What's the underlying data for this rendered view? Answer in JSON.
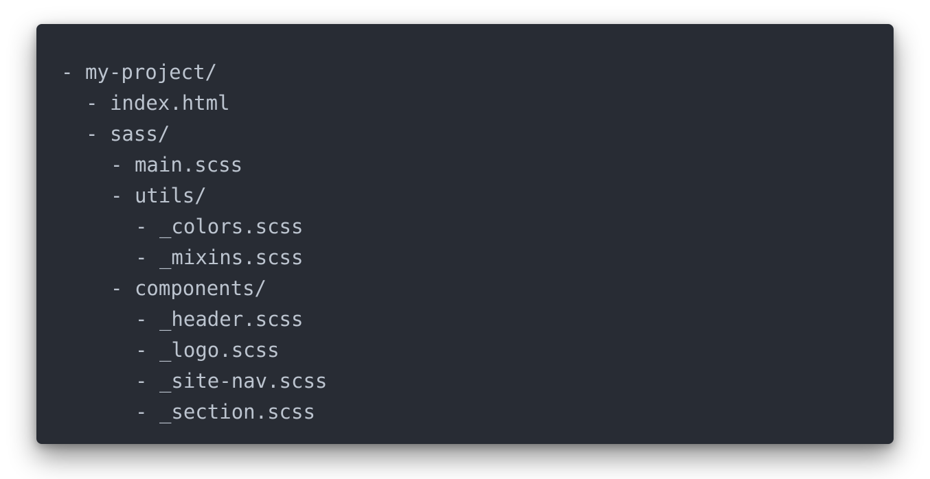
{
  "colors": {
    "background": "#282c34",
    "text": "#bcc4cf",
    "page": "#ffffff"
  },
  "tree": [
    {
      "depth": 0,
      "dash": "-",
      "name": "my-project/"
    },
    {
      "depth": 1,
      "dash": "-",
      "name": "index.html"
    },
    {
      "depth": 1,
      "dash": "-",
      "name": "sass/"
    },
    {
      "depth": 2,
      "dash": "-",
      "name": "main.scss"
    },
    {
      "depth": 2,
      "dash": "-",
      "name": "utils/"
    },
    {
      "depth": 3,
      "dash": "-",
      "name": "_colors.scss"
    },
    {
      "depth": 3,
      "dash": "-",
      "name": "_mixins.scss"
    },
    {
      "depth": 2,
      "dash": "-",
      "name": "components/"
    },
    {
      "depth": 3,
      "dash": "-",
      "name": "_header.scss"
    },
    {
      "depth": 3,
      "dash": "-",
      "name": "_logo.scss"
    },
    {
      "depth": 3,
      "dash": "-",
      "name": "_site-nav.scss"
    },
    {
      "depth": 3,
      "dash": "-",
      "name": "_section.scss"
    }
  ]
}
